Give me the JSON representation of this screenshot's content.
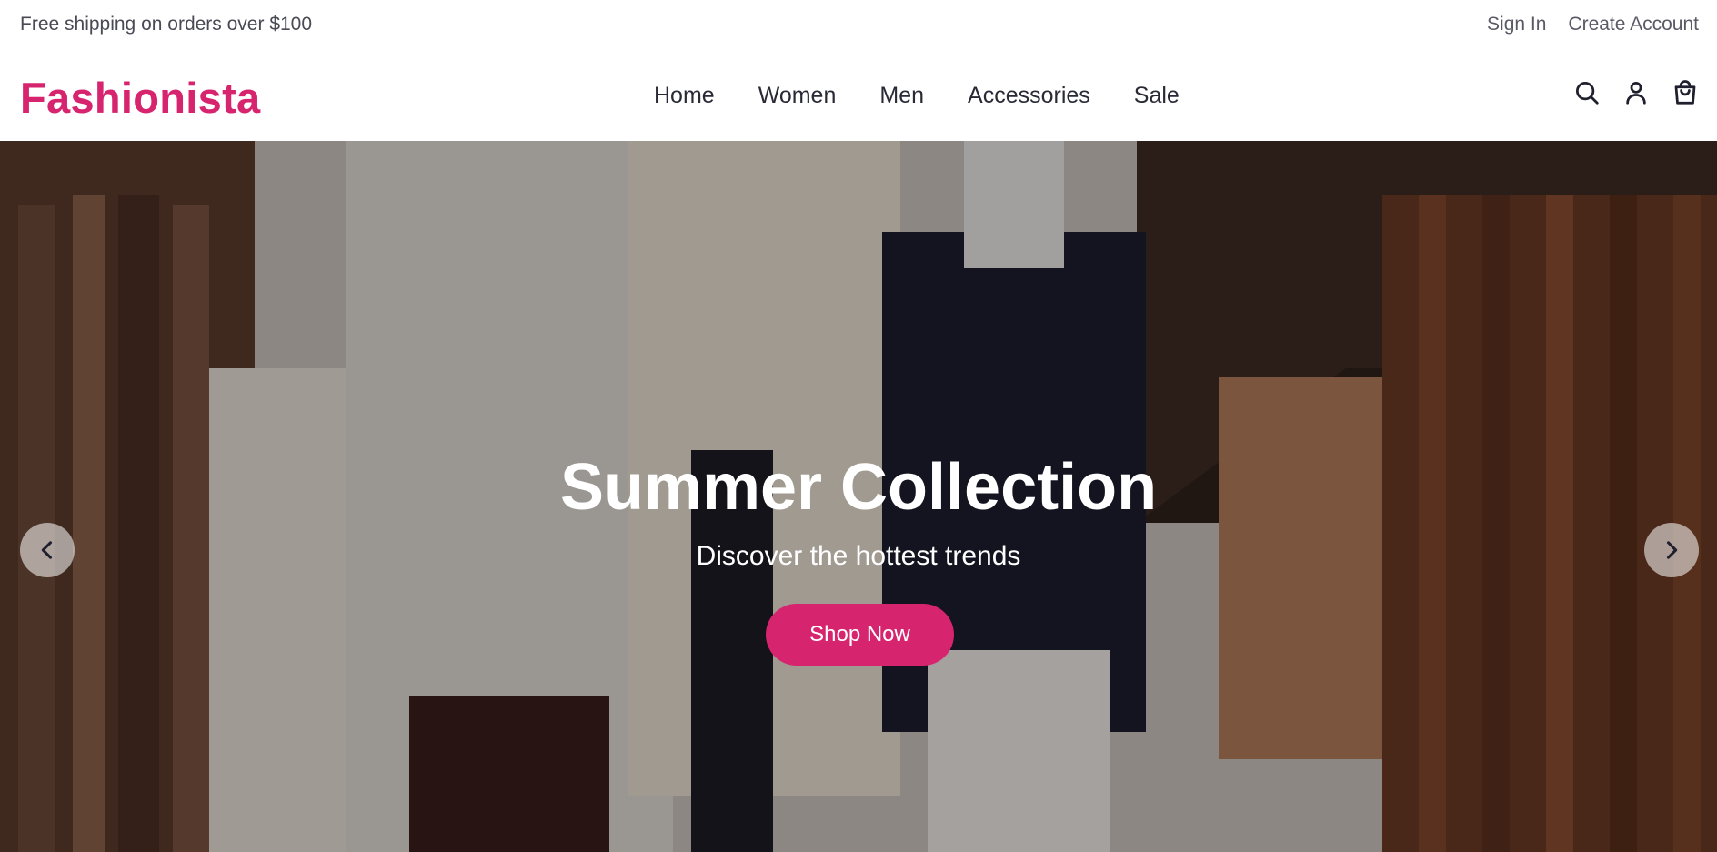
{
  "topbar": {
    "promo": "Free shipping on orders over $100",
    "sign_in": "Sign In",
    "create_account": "Create Account"
  },
  "header": {
    "logo": "Fashionista",
    "nav": [
      "Home",
      "Women",
      "Men",
      "Accessories",
      "Sale"
    ],
    "icons": [
      "search-icon",
      "user-icon",
      "shopping-bag-icon"
    ]
  },
  "hero": {
    "title": "Summer Collection",
    "subtitle": "Discover the hottest trends",
    "cta": "Shop Now",
    "prev_icon": "chevron-left-icon",
    "next_icon": "chevron-right-icon"
  },
  "colors": {
    "brand": "#d6246e",
    "text": "#1f1f2e"
  }
}
